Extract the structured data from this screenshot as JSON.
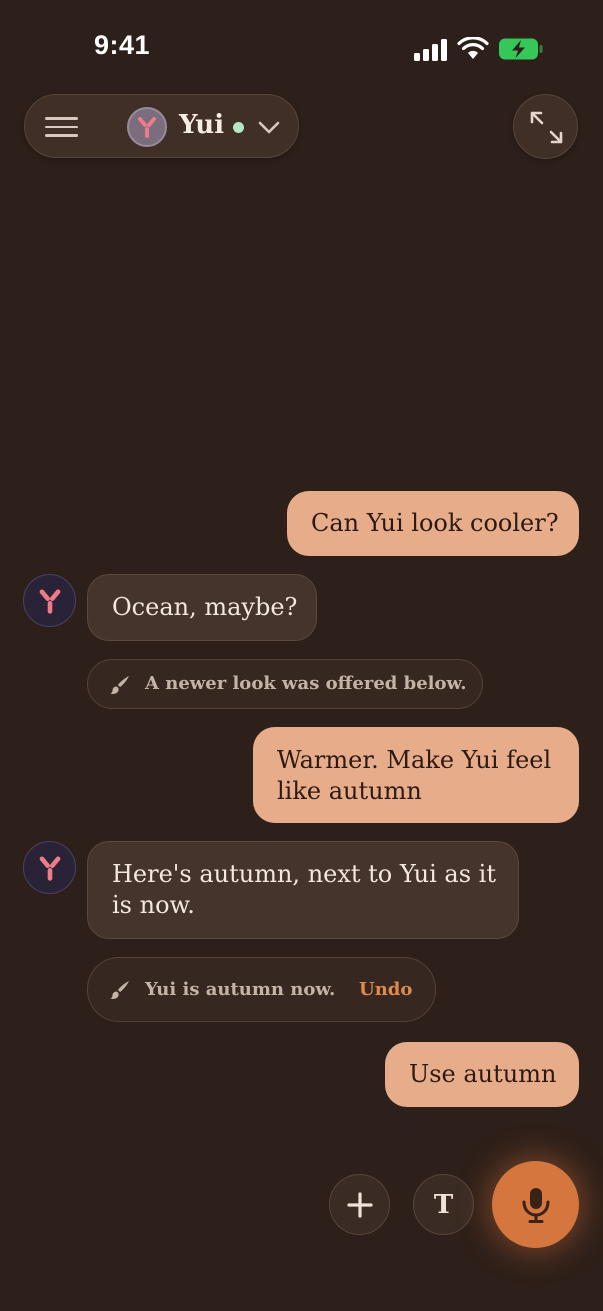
{
  "status_bar": {
    "time": "9:41",
    "icons": [
      "signal-icon",
      "wifi-icon",
      "battery-charging-icon"
    ],
    "battery_color": "#35c759"
  },
  "header": {
    "agent_name": "Yui",
    "online_color": "#b6e7c4",
    "icons": [
      "menu-icon",
      "agent-avatar-icon",
      "chevron-down-icon",
      "expand-icon"
    ]
  },
  "conversation": {
    "msg1_user": "Can Yui look cooler?",
    "msg2_agent": "Ocean, maybe?",
    "msg3_system": "A newer look was offered below.",
    "msg4_user_line1": "Warmer. Make Yui feel",
    "msg4_user_line2": "like autumn",
    "msg5_agent_line1": "Here's autumn, next to Yui as it",
    "msg5_agent_line2": "is now.",
    "msg6_system": "Yui is autumn now.",
    "msg6_undo": "Undo",
    "msg7_user": "Use autumn"
  },
  "composer": {
    "text_mode_label": "T",
    "icons": [
      "plus-icon",
      "microphone-icon"
    ]
  },
  "colors": {
    "background": "#2d1f19",
    "user_bubble": "#e7ad8b",
    "agent_bubble": "#44342b",
    "accent": "#d6763f",
    "undo": "#e08a4d"
  }
}
